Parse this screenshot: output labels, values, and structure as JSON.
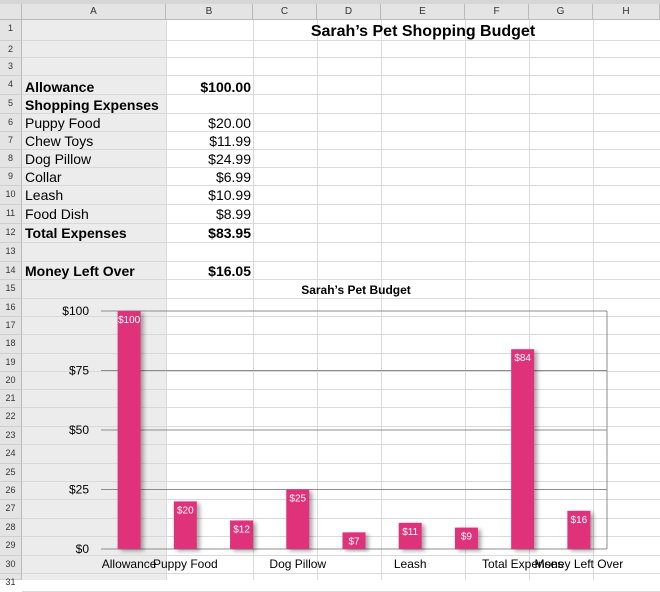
{
  "columns": [
    "A",
    "B",
    "C",
    "D",
    "E",
    "F",
    "G",
    "H"
  ],
  "rows": [
    "1",
    "2",
    "3",
    "4",
    "5",
    "6",
    "7",
    "8",
    "9",
    "10",
    "11",
    "12",
    "13",
    "14",
    "15",
    "16",
    "17",
    "18",
    "19",
    "20",
    "21",
    "22",
    "23",
    "24",
    "25",
    "26",
    "27",
    "28",
    "29",
    "30",
    "31"
  ],
  "sheet": {
    "title": "Sarah’s Pet Shopping Budget",
    "allowance": {
      "label": "Allowance",
      "value": "$100.00"
    },
    "expenses_header": "Shopping Expenses",
    "items": [
      {
        "label": "Puppy Food",
        "value": "$20.00"
      },
      {
        "label": "Chew Toys",
        "value": "$11.99"
      },
      {
        "label": "Dog Pillow",
        "value": "$24.99"
      },
      {
        "label": "Collar",
        "value": "$6.99"
      },
      {
        "label": "Leash",
        "value": "$10.99"
      },
      {
        "label": "Food Dish",
        "value": "$8.99"
      }
    ],
    "total": {
      "label": "Total Expenses",
      "value": "$83.95"
    },
    "left_over": {
      "label": "Money Left Over",
      "value": "$16.05"
    }
  },
  "chart_data": {
    "type": "bar",
    "title": "Sarah’s Pet Budget",
    "categories": [
      "Allowance",
      "Puppy Food",
      "Chew Toys",
      "Dog Pillow",
      "Collar",
      "Leash",
      "Food Dish",
      "Total Expenses",
      "Money Left Over"
    ],
    "values": [
      100,
      20,
      11.99,
      24.99,
      6.99,
      10.99,
      8.99,
      83.95,
      16.05
    ],
    "data_labels": [
      "$100",
      "$20",
      "$12",
      "$25",
      "$7",
      "$11",
      "$9",
      "$84",
      "$16"
    ],
    "x_tick_labels": [
      "Allowance",
      "Puppy Food",
      "",
      "Dog Pillow",
      "",
      "Leash",
      "",
      "Total Expenses",
      "Money Left Over"
    ],
    "y_ticks": [
      "$0",
      "$25",
      "$50",
      "$75",
      "$100"
    ],
    "ylim": [
      0,
      100
    ],
    "grid": true,
    "bar_color": "#e0307a"
  }
}
